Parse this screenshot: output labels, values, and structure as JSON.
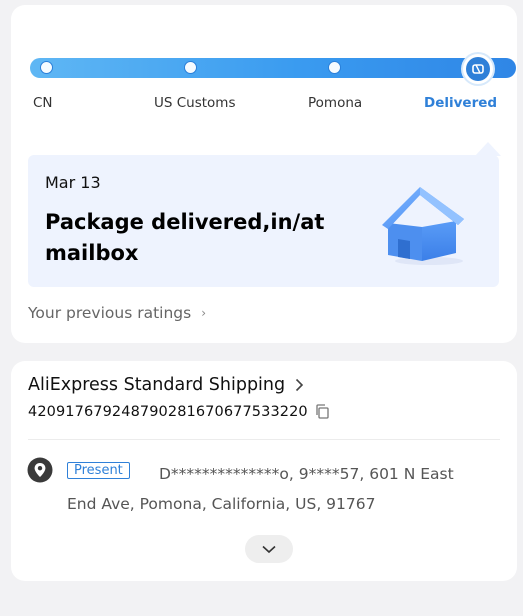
{
  "tracking": {
    "stops": [
      "CN",
      "US Customs",
      "Pomona",
      "Delivered"
    ],
    "latest_event": {
      "date": "Mar 13",
      "status": "Package delivered,in/at mailbox"
    },
    "ratings_link": "Your previous ratings"
  },
  "shipping": {
    "method": "AliExpress Standard Shipping",
    "tracking_number": "420917679248790281670677533220",
    "address_badge": "Present",
    "address": "D**************o, 9****57, 601 N East End Ave, Pomona, California, US, 91767"
  },
  "colors": {
    "accent": "#2f80d8",
    "progress_start": "#5fb7f4",
    "progress_end": "#2f86e6",
    "panel_bg": "#eef3fe"
  },
  "icons": [
    "house-icon",
    "chevron-right-icon",
    "copy-icon",
    "location-pin-icon",
    "chevron-down-icon"
  ]
}
